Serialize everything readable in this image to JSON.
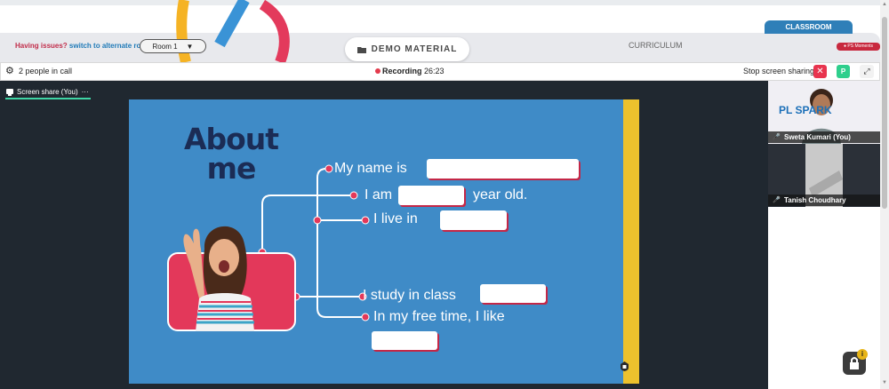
{
  "header": {
    "issues_label": "Having issues?",
    "switch_link": "switch to alternate room",
    "room_select": "Room 1",
    "demo_material": "DEMO MATERIAL",
    "curriculum": "CURRICULUM",
    "classroom_tab": "CLASSROOM",
    "ps_moments": "PS Moments"
  },
  "call_bar": {
    "people": "2 people in call",
    "recording_label": "Recording",
    "recording_time": "26:23",
    "stop_share": "Stop screen sharing",
    "p_badge": "P",
    "close_symbol": "✕",
    "expand_symbol": "⤢"
  },
  "stage": {
    "screen_share_tab": "Screen share (You)",
    "tab_more": "···"
  },
  "slide": {
    "title_line1": "About",
    "title_line2": "me",
    "lines": [
      {
        "before": "My name is",
        "after": ""
      },
      {
        "before": "I am",
        "after": "year old."
      },
      {
        "before": "I live in",
        "after": ""
      },
      {
        "before": "I study in class",
        "after": ""
      },
      {
        "before": "In my free time, I like",
        "after": ""
      }
    ]
  },
  "participants": [
    {
      "name": "Sweta Kumari (You)",
      "logo": "PL SPARK"
    },
    {
      "name": "Tanish Choudhary"
    }
  ],
  "info_badge": "i",
  "colors": {
    "slide_blue": "#3f8bc7",
    "accent_red": "#e3385a",
    "accent_yellow": "#ecc12d",
    "title_navy": "#1b2c55",
    "recording_red": "#e33a4c",
    "green_badge": "#2ecf8c"
  }
}
